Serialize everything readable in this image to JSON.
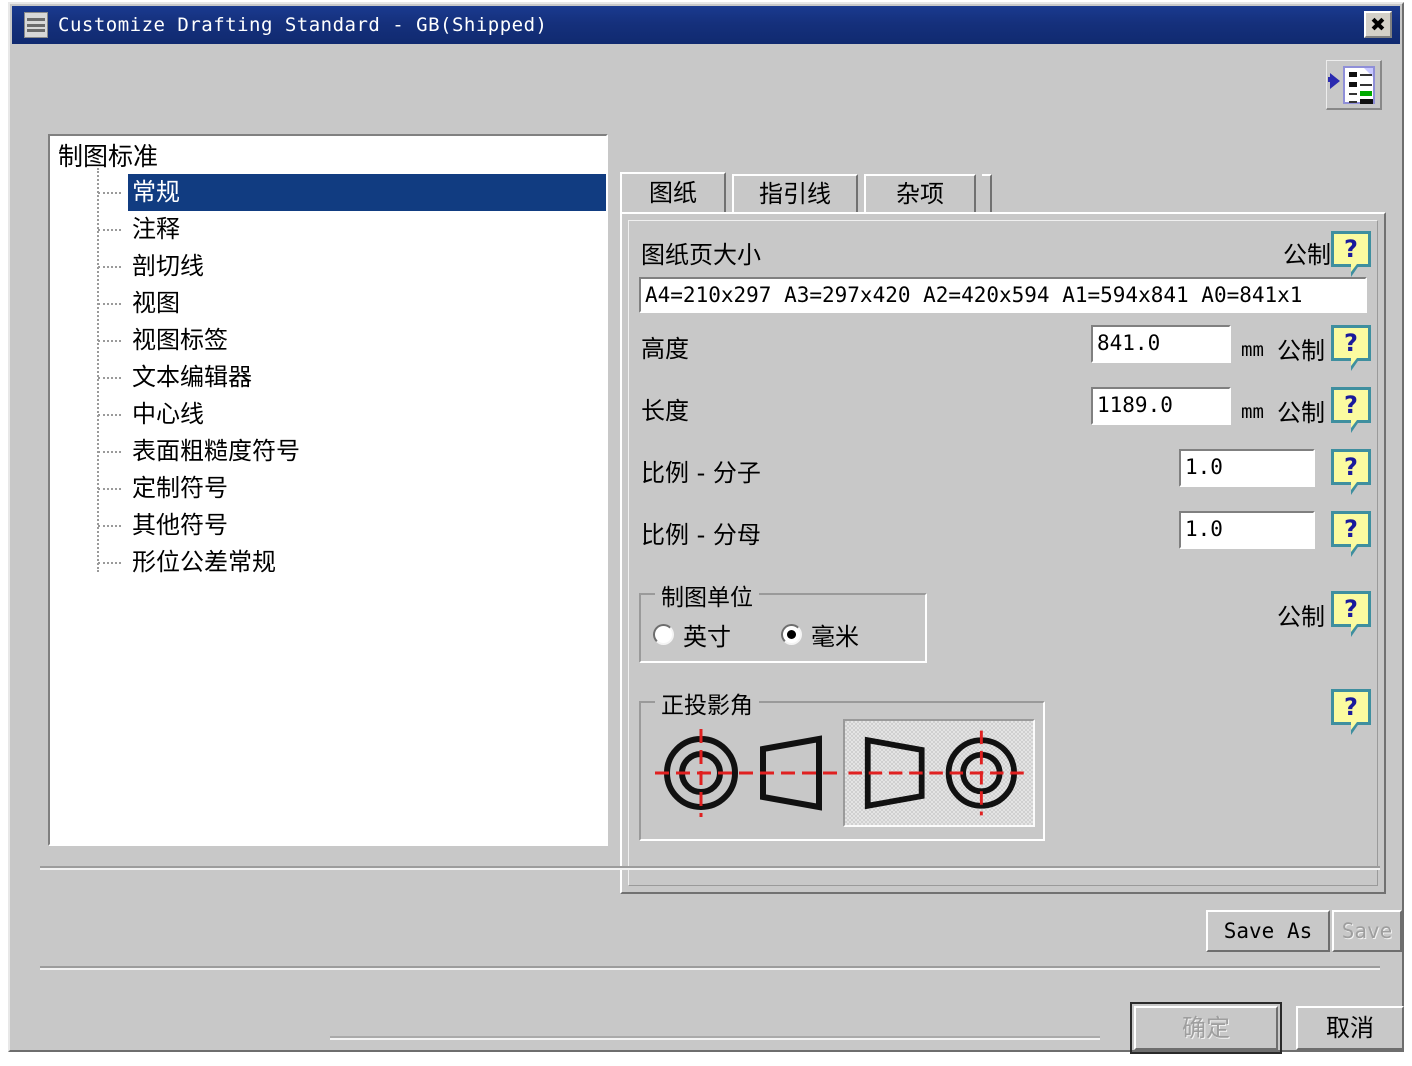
{
  "window": {
    "title": "Customize Drafting Standard - GB(Shipped)",
    "title_icon": "document-lines-icon",
    "close_label": "✖",
    "toolbar_icon": "page-properties-icon"
  },
  "tree": {
    "root": "制图标准",
    "items": [
      {
        "label": "常规",
        "selected": true
      },
      {
        "label": "注释",
        "selected": false
      },
      {
        "label": "剖切线",
        "selected": false
      },
      {
        "label": "视图",
        "selected": false
      },
      {
        "label": "视图标签",
        "selected": false
      },
      {
        "label": "文本编辑器",
        "selected": false
      },
      {
        "label": "中心线",
        "selected": false
      },
      {
        "label": "表面粗糙度符号",
        "selected": false
      },
      {
        "label": "定制符号",
        "selected": false
      },
      {
        "label": "其他符号",
        "selected": false
      },
      {
        "label": "形位公差常规",
        "selected": false
      }
    ]
  },
  "tabs": [
    {
      "label": "图纸",
      "active": true
    },
    {
      "label": "指引线",
      "active": false
    },
    {
      "label": "杂项",
      "active": false
    }
  ],
  "panel": {
    "paper_size": {
      "label": "图纸页大小",
      "unit_system": "公制",
      "value": "A4=210x297  A3=297x420  A2=420x594  A1=594x841  A0=841x1",
      "help": "?"
    },
    "height": {
      "label": "高度",
      "value": "841.0",
      "unit": "mm",
      "unit_system": "公制",
      "help": "?"
    },
    "length": {
      "label": "长度",
      "value": "1189.0",
      "unit": "mm",
      "unit_system": "公制",
      "help": "?"
    },
    "scale_numerator": {
      "label": "比例 - 分子",
      "value": "1.0",
      "help": "?"
    },
    "scale_denominator": {
      "label": "比例 - 分母",
      "value": "1.0",
      "help": "?"
    },
    "drafting_units": {
      "group_title": "制图单位",
      "unit_system": "公制",
      "help": "?",
      "options": [
        {
          "label": "英寸",
          "checked": false
        },
        {
          "label": "毫米",
          "checked": true
        }
      ]
    },
    "projection_angle": {
      "group_title": "正投影角",
      "help": "?",
      "options": [
        {
          "name": "first-angle-projection",
          "selected": false
        },
        {
          "name": "third-angle-projection",
          "selected": true
        }
      ]
    }
  },
  "footer": {
    "save_as": "Save As",
    "save": "Save",
    "save_disabled": true,
    "ok": "确定",
    "ok_disabled": true,
    "cancel": "取消"
  },
  "colors": {
    "titlebar": "#15307c",
    "selection": "#113c81",
    "face": "#c8c8c8",
    "help_fill": "#fbfba0",
    "help_border": "#3f8f9f",
    "help_glyph": "#1a1a9c",
    "centerline": "#e02020"
  }
}
